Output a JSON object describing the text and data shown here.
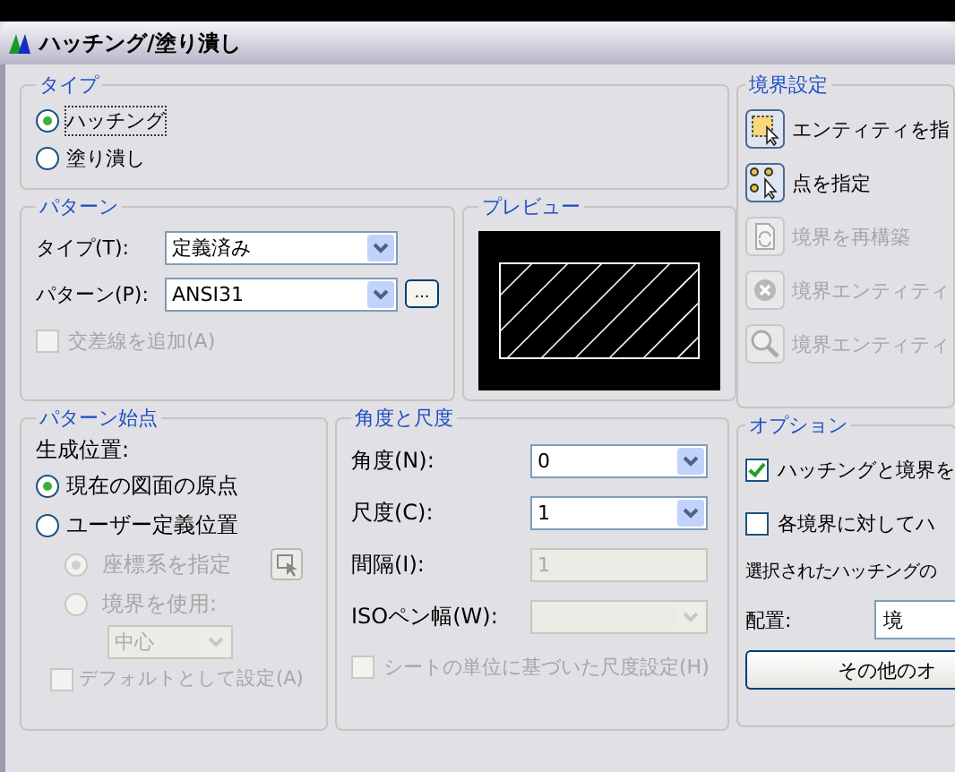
{
  "window": {
    "title": "ハッチング/塗り潰し"
  },
  "type_group": {
    "title": "タイプ",
    "options": [
      {
        "label": "ハッチング",
        "selected": true
      },
      {
        "label": "塗り潰し",
        "selected": false
      }
    ]
  },
  "pattern_group": {
    "title": "パターン",
    "fields": [
      {
        "label": "タイプ(T):",
        "value": "定義済み"
      },
      {
        "label": "パターン(P):",
        "value": "ANSI31"
      }
    ],
    "browse": "...",
    "crosshatch": {
      "label": "交差線を追加(A)",
      "checked": false,
      "disabled": true
    }
  },
  "preview": {
    "title": "プレビュー"
  },
  "origin_group": {
    "title": "パターン始点",
    "caption": "生成位置:",
    "options": [
      {
        "label": "現在の図面の原点",
        "selected": true,
        "disabled": false
      },
      {
        "label": "ユーザー定義位置",
        "selected": false,
        "disabled": false
      }
    ],
    "sub_options": [
      {
        "label": "座標系を指定",
        "selected": true,
        "disabled": true
      },
      {
        "label": "境界を使用:",
        "selected": false,
        "disabled": true
      }
    ],
    "position": {
      "value": "中心",
      "disabled": true
    },
    "default": {
      "label": "デフォルトとして設定(A)",
      "checked": false,
      "disabled": true
    }
  },
  "angle_group": {
    "title": "角度と尺度",
    "fields": [
      {
        "label": "角度(N):",
        "value": "0",
        "kind": "combo",
        "disabled": false
      },
      {
        "label": "尺度(C):",
        "value": "1",
        "kind": "combo",
        "disabled": false
      },
      {
        "label": "間隔(I):",
        "value": "1",
        "kind": "text",
        "disabled": true
      },
      {
        "label": "ISOペン幅(W):",
        "kind": "combo",
        "disabled": true
      }
    ],
    "sheet_units": {
      "label": "シートの単位に基づいた尺度設定(H)",
      "checked": false,
      "disabled": true
    }
  },
  "boundary_group": {
    "title": "境界設定",
    "buttons": [
      {
        "label": "エンティティを指",
        "kind": "select",
        "disabled": false
      },
      {
        "label": "点を指定",
        "kind": "pick",
        "disabled": false
      },
      {
        "label": "境界を再構築",
        "kind": "rebuild",
        "disabled": true
      },
      {
        "label": "境界エンティティ",
        "kind": "remove",
        "disabled": true
      },
      {
        "label": "境界エンティティ",
        "kind": "view",
        "disabled": true
      }
    ]
  },
  "options_group": {
    "title": "オプション",
    "checks": [
      {
        "label": "ハッチングと境界を",
        "checked": true
      },
      {
        "label": "各境界に対してハ",
        "checked": false
      }
    ],
    "note": "選択されたハッチングの",
    "placement": {
      "label": "配置:",
      "value": "境"
    },
    "more_button": "その他のオ"
  }
}
